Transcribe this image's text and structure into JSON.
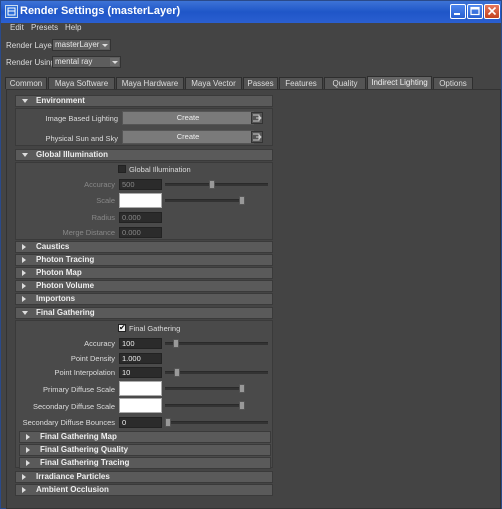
{
  "window": {
    "title": "Render Settings (masterLayer)"
  },
  "menu": [
    "Edit",
    "Presets",
    "Help"
  ],
  "render_layer": {
    "label": "Render Layer",
    "value": "masterLayer"
  },
  "render_using": {
    "label": "Render Using",
    "value": "mental ray"
  },
  "tabs": [
    "Common",
    "Maya Software",
    "Maya Hardware",
    "Maya Vector",
    "Passes",
    "Features",
    "Quality",
    "Indirect Lighting",
    "Options"
  ],
  "active_tab": "Indirect Lighting",
  "environment": {
    "title": "Environment",
    "ibl_label": "Image Based Lighting",
    "ibl_button": "Create",
    "sun_label": "Physical Sun and Sky",
    "sun_button": "Create"
  },
  "gi": {
    "title": "Global Illumination",
    "checkbox_label": "Global Illumination",
    "checked": false,
    "accuracy_label": "Accuracy",
    "accuracy": "500",
    "scale_label": "Scale",
    "radius_label": "Radius",
    "radius": "0.000",
    "merge_label": "Merge Distance",
    "merge": "0.000"
  },
  "collapsed1": [
    "Caustics",
    "Photon Tracing",
    "Photon Map",
    "Photon Volume",
    "Importons"
  ],
  "fg": {
    "title": "Final Gathering",
    "checkbox_label": "Final Gathering",
    "checked": true,
    "accuracy_label": "Accuracy",
    "accuracy": "100",
    "density_label": "Point Density",
    "density": "1.000",
    "interp_label": "Point Interpolation",
    "interp": "10",
    "primary_label": "Primary Diffuse Scale",
    "secondary_label": "Secondary Diffuse Scale",
    "bounces_label": "Secondary Diffuse Bounces",
    "bounces": "0",
    "subsections": [
      "Final Gathering Map",
      "Final Gathering Quality",
      "Final Gathering Tracing"
    ]
  },
  "collapsed2": [
    "Irradiance Particles",
    "Ambient Occlusion"
  ]
}
